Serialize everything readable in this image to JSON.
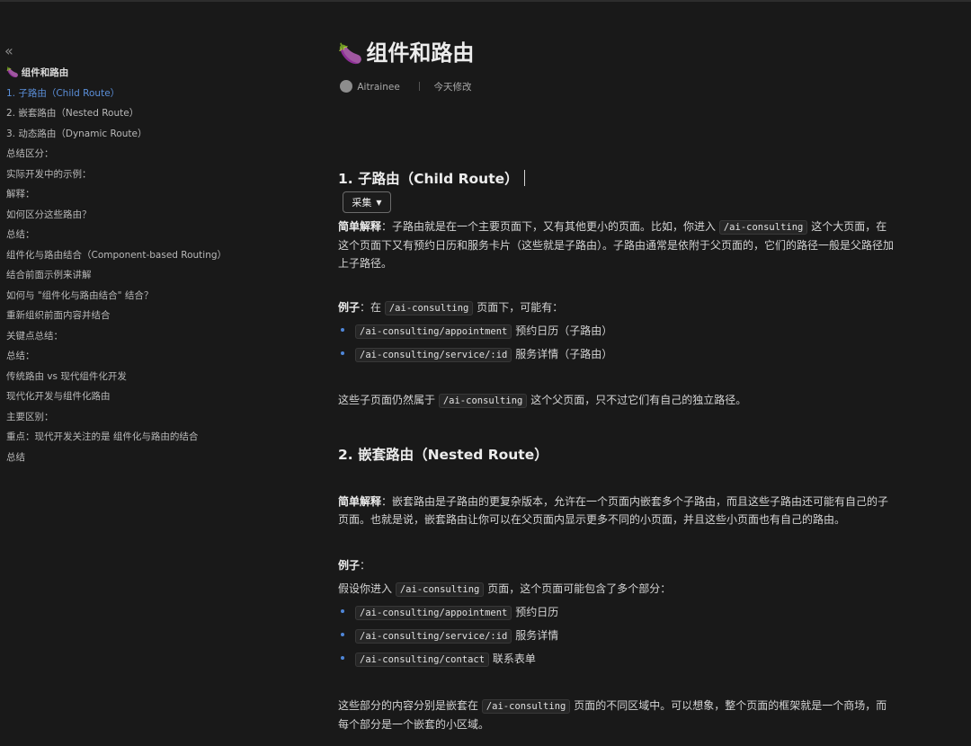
{
  "sidebar": {
    "collapse_icon": "«",
    "toc": [
      {
        "label": "组件和路由",
        "kind": "title"
      },
      {
        "label": "1. 子路由（Child Route）",
        "kind": "active"
      },
      {
        "label": "2. 嵌套路由（Nested Route）"
      },
      {
        "label": "3. 动态路由（Dynamic Route）"
      },
      {
        "label": "总结区分："
      },
      {
        "label": "实际开发中的示例："
      },
      {
        "label": "解释："
      },
      {
        "label": "如何区分这些路由？"
      },
      {
        "label": "总结："
      },
      {
        "label": "组件化与路由结合（Component-based Routing）"
      },
      {
        "label": "结合前面示例来讲解"
      },
      {
        "label": "如何与 \"组件化与路由结合\" 结合？"
      },
      {
        "label": "重新组织前面内容并结合"
      },
      {
        "label": "关键点总结："
      },
      {
        "label": "总结："
      },
      {
        "label": "传统路由 vs 现代组件化开发"
      },
      {
        "label": "现代化开发与组件化路由"
      },
      {
        "label": "主要区别："
      },
      {
        "label": "重点：现代开发关注的是 组件化与路由的结合"
      },
      {
        "label": "总结"
      }
    ]
  },
  "page": {
    "icon": "🍆",
    "title": "组件和路由",
    "author": "Aitrainee",
    "modified": "今天修改"
  },
  "section1": {
    "heading": "1. 子路由（Child Route）",
    "collect_label": "采集",
    "simple_label": "简单解释",
    "simple_text": "：子路由就是在一个主要页面下，又有其他更小的页面。比如，你进入",
    "simple_code": "/ai-consulting",
    "simple_text2": "这个大页面，在这个页面下又有预约日历和服务卡片（这些就是子路由）。子路由通常是依附于父页面的，它们的路径一般是父路径加上子路径。",
    "example_label": "例子",
    "example_pre": "：在",
    "example_code": "/ai-consulting",
    "example_post": "页面下，可能有：",
    "bullets": [
      {
        "code": "/ai-consulting/appointment",
        "text": "预约日历（子路由）"
      },
      {
        "code": "/ai-consulting/service/:id",
        "text": "服务详情（子路由）"
      }
    ],
    "note_pre": "这些子页面仍然属于",
    "note_code": "/ai-consulting",
    "note_post": "这个父页面，只不过它们有自己的独立路径。"
  },
  "section2": {
    "heading": "2. 嵌套路由（Nested Route）",
    "simple_label": "简单解释",
    "simple_text": "：嵌套路由是子路由的更复杂版本，允许在一个页面内嵌套多个子路由，而且这些子路由还可能有自己的子页面。也就是说，嵌套路由让你可以在父页面内显示更多不同的小页面，并且这些小页面也有自己的路由。",
    "example_label": "例子",
    "example_colon": "：",
    "assume_pre": "假设你进入",
    "assume_code": "/ai-consulting",
    "assume_post": "页面，这个页面可能包含了多个部分：",
    "bullets": [
      {
        "code": "/ai-consulting/appointment",
        "text": "预约日历"
      },
      {
        "code": "/ai-consulting/service/:id",
        "text": "服务详情"
      },
      {
        "code": "/ai-consulting/contact",
        "text": "联系表单"
      }
    ],
    "note_pre": "这些部分的内容分别是嵌套在",
    "note_code": "/ai-consulting",
    "note_post": "页面的不同区域中。可以想象，整个页面的框架就是一个商场，而每个部分是一个嵌套的小区域。"
  }
}
